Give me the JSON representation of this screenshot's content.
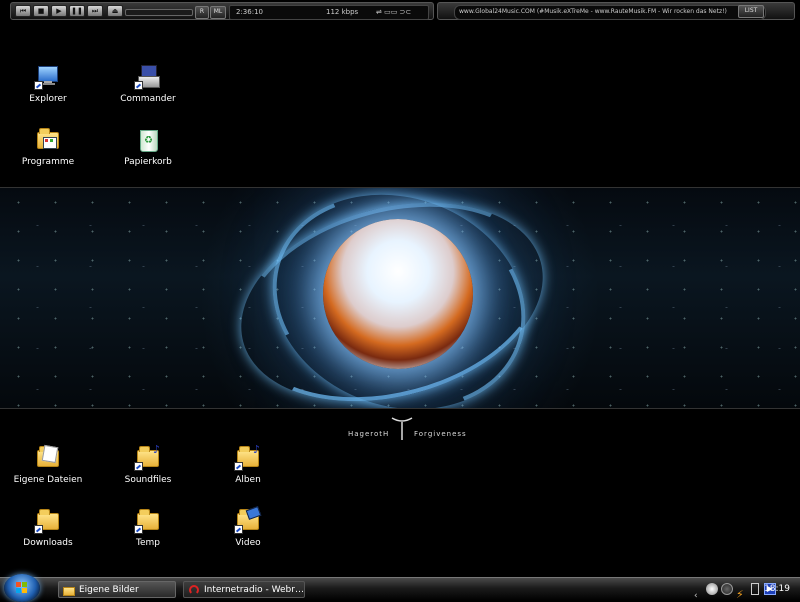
{
  "player": {
    "buttons": [
      "prev",
      "stop",
      "play",
      "pause",
      "next",
      "eject"
    ],
    "shuffle_label": "R",
    "repeat_label": "ML",
    "time": "2:36:10",
    "bitrate": "112 kbps"
  },
  "playlist": {
    "now_playing": "www.Global24Music.COM (#Musik.eXTreMe - www.RauteMusik.FM - Wir rocken das Netz!)",
    "list_button": "LIST"
  },
  "desktop": {
    "top_icons": [
      {
        "label": "Explorer",
        "icon": "explorer-icon"
      },
      {
        "label": "Commander",
        "icon": "commander-icon"
      },
      {
        "label": "Programme",
        "icon": "programs-folder-icon"
      },
      {
        "label": "Papierkorb",
        "icon": "recycle-bin-icon"
      }
    ],
    "bottom_icons": [
      {
        "label": "Eigene Dateien",
        "icon": "my-documents-icon"
      },
      {
        "label": "Soundfiles",
        "icon": "music-folder-icon"
      },
      {
        "label": "Alben",
        "icon": "music-folder-icon"
      },
      {
        "label": "Downloads",
        "icon": "folder-icon"
      },
      {
        "label": "Temp",
        "icon": "folder-icon"
      },
      {
        "label": "Video",
        "icon": "video-folder-icon"
      }
    ]
  },
  "wallpaper": {
    "left_text": "HagerotH",
    "right_text": "Forgiveness"
  },
  "taskbar": {
    "tasks": [
      {
        "label": "Eigene Bilder",
        "icon": "folder-icon"
      },
      {
        "label": "Internetradio - Webr…",
        "icon": "radio-icon"
      }
    ],
    "clock": "18:19"
  },
  "colors": {
    "taskbar_bg": "#1a1a1a",
    "accent": "#3f86d6"
  }
}
